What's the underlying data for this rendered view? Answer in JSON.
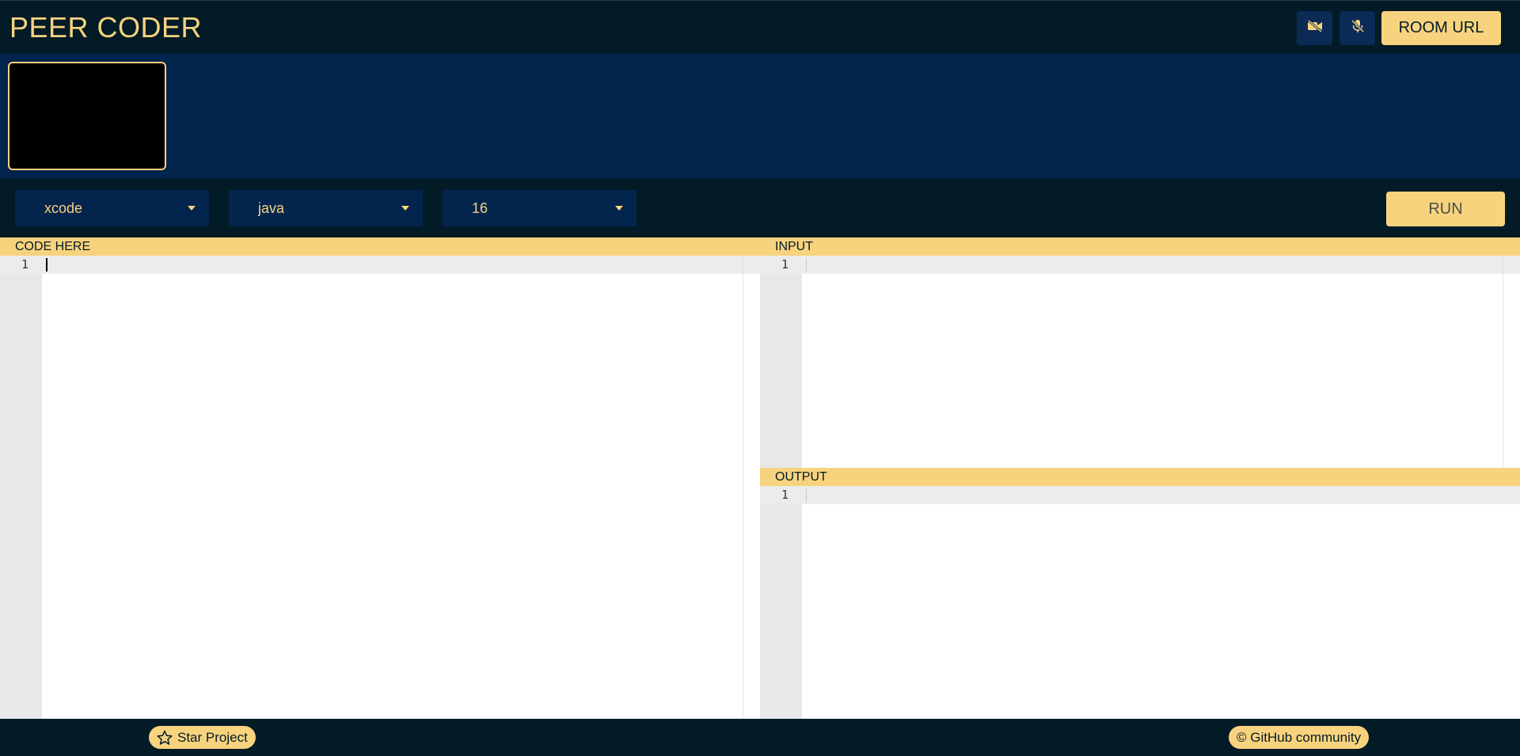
{
  "header": {
    "title": "PEER CODER",
    "video_toggle_icon": "video-off-icon",
    "mic_toggle_icon": "mic-off-icon",
    "room_url_label": "ROOM URL"
  },
  "toolbar": {
    "theme_select": {
      "value": "xcode"
    },
    "language_select": {
      "value": "java"
    },
    "font_size_select": {
      "value": "16"
    },
    "run_label": "RUN"
  },
  "panes": {
    "code": {
      "label": "CODE HERE",
      "line_numbers": [
        "1"
      ]
    },
    "input": {
      "label": "INPUT",
      "line_numbers": [
        "1"
      ]
    },
    "output": {
      "label": "OUTPUT",
      "line_numbers": [
        "1"
      ]
    }
  },
  "footer": {
    "star_label": "Star Project",
    "community_label": "© GitHub community"
  },
  "colors": {
    "accent": "#f8d37e",
    "header_bg": "#031b26",
    "video_strip_bg": "#03244d",
    "select_bg": "#03244d"
  }
}
